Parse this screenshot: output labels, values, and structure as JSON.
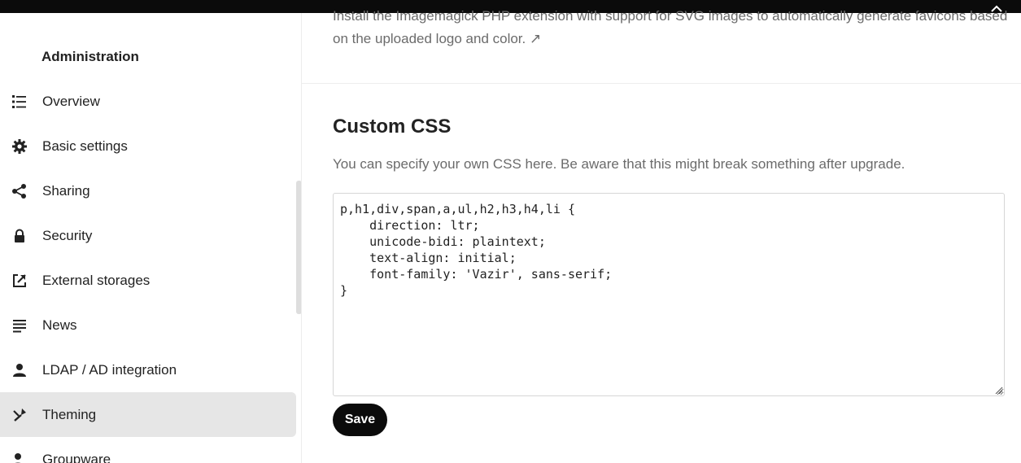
{
  "sidebar": {
    "heading": "Administration",
    "items": [
      {
        "label": "Overview",
        "icon": "list-icon",
        "active": false
      },
      {
        "label": "Basic settings",
        "icon": "gear-icon",
        "active": false
      },
      {
        "label": "Sharing",
        "icon": "share-icon",
        "active": false
      },
      {
        "label": "Security",
        "icon": "lock-icon",
        "active": false
      },
      {
        "label": "External storages",
        "icon": "external-link-icon",
        "active": false
      },
      {
        "label": "News",
        "icon": "news-icon",
        "active": false
      },
      {
        "label": "LDAP / AD integration",
        "icon": "user-icon",
        "active": false
      },
      {
        "label": "Theming",
        "icon": "brush-icon",
        "active": true
      },
      {
        "label": "Groupware",
        "icon": "groupware-icon",
        "active": false
      }
    ]
  },
  "main": {
    "intro_text": "Install the Imagemagick PHP extension with support for SVG images to automatically generate favicons based on the uploaded logo and color. ↗",
    "custom_css": {
      "title": "Custom CSS",
      "description": "You can specify your own CSS here. Be aware that this might break something after upgrade.",
      "value": "p,h1,div,span,a,ul,h2,h3,h4,li {\n    direction: ltr;\n    unicode-bidi: plaintext;\n    text-align: initial;\n    font-family: 'Vazir', sans-serif;\n}",
      "save_label": "Save"
    }
  },
  "colors": {
    "topbar": "#0b0b0b",
    "active_item": "#e6e6e6",
    "primary_button": "#0b0b0b",
    "muted_text": "#6b6b6b"
  }
}
